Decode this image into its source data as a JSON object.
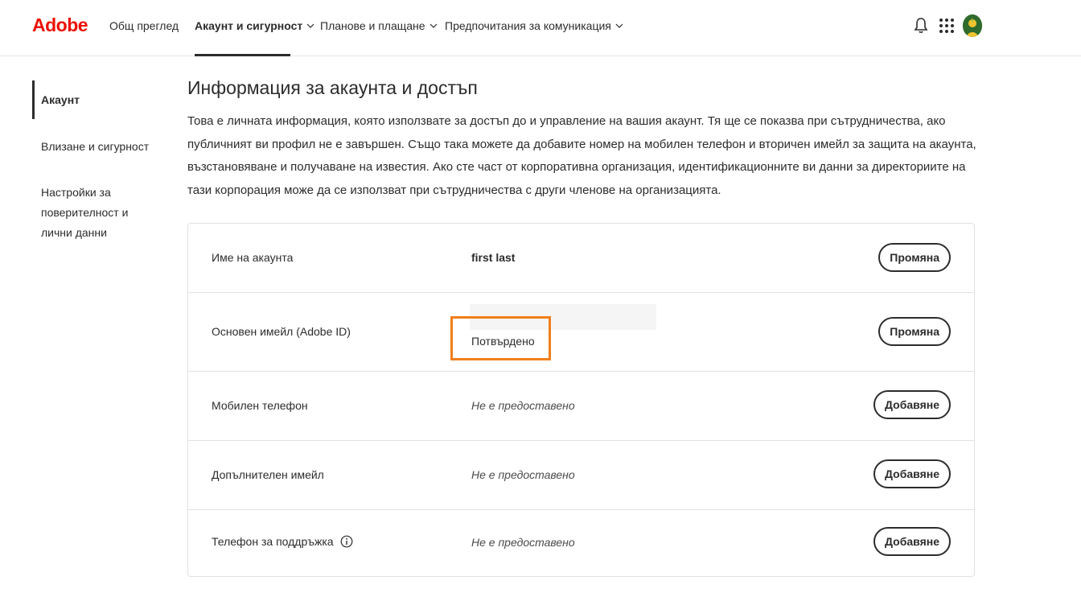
{
  "header": {
    "logo": "Adobe",
    "nav": [
      {
        "label": "Общ преглед",
        "dropdown": false,
        "active": false
      },
      {
        "label": "Акаунт и сигурност",
        "dropdown": true,
        "active": true
      },
      {
        "label": "Планове и плащане",
        "dropdown": true,
        "active": false
      },
      {
        "label": "Предпочитания за комуникация",
        "dropdown": true,
        "active": false
      }
    ],
    "icons": [
      "bell-icon",
      "apps-grid-icon",
      "avatar"
    ]
  },
  "sidebar": {
    "items": [
      {
        "label": "Акаунт",
        "active": true
      },
      {
        "label": "Влизане и сигурност",
        "active": false
      },
      {
        "label": "Настройки за поверителност и лични данни",
        "active": false
      }
    ]
  },
  "main": {
    "title": "Информация за акаунта и достъп",
    "intro": "Това е личната информация, която използвате за достъп до и управление на вашия акаунт. Тя ще се показва при сътрудничества, ако публичният ви профил не е завършен. Също така можете да добавите номер на мобилен телефон и вторичен имейл за защита на акаунта, възстановяване и получаване на известия. Ако сте част от корпоративна организация, идентификационните ви данни за директориите на тази корпорация може да се използват при сътрудничества с други членове на организацията.",
    "rows": [
      {
        "label": "Име на акаунта",
        "value": "first last",
        "button": "Промяна"
      },
      {
        "label": "Основен имейл (Adobe ID)",
        "value": "Потвърдено",
        "button": "Промяна"
      },
      {
        "label": "Мобилен телефон",
        "value": "Не е предоставено",
        "button": "Добавяне"
      },
      {
        "label": "Допълнителен имейл",
        "value": "Не е предоставено",
        "button": "Добавяне"
      },
      {
        "label": "Телефон за поддръжка",
        "value": "Не е предоставено",
        "button": "Добавяне"
      }
    ]
  },
  "colors": {
    "brand": "#eb1000",
    "highlight": "#f07f1a",
    "text": "#2c2c2c"
  }
}
